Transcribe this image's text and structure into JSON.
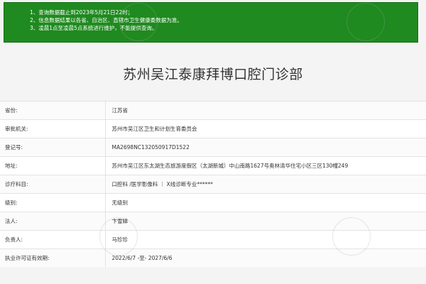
{
  "notice": {
    "lines": [
      "1、查询数据截止到2023年5月21日22时；",
      "2、信息数据结果以各省、自治区、直辖市卫生健康委数据为准。",
      "3、凌晨1点至凌晨5点系统进行维护，不能提供查询。"
    ]
  },
  "page_title": "苏州吴江泰康拜博口腔门诊部",
  "rows": [
    {
      "label": "省份:",
      "value": "江苏省"
    },
    {
      "label": "审批机关:",
      "value": "苏州市吴江区卫生和计划生育委员会"
    },
    {
      "label": "登记号:",
      "value": "MA2698NC132050917D1522"
    },
    {
      "label": "地址:",
      "value": "苏州市吴江区东太湖生态旅游度假区（太湖新城）中山南路1627号奥林清华住宅小区三区130幢249"
    },
    {
      "label": "诊疗科目:",
      "value": "口腔科 /医学影像科 ｜ X线诊断专业******"
    },
    {
      "label": "级别:",
      "value": "无级别"
    },
    {
      "label": "法人:",
      "value": "卞雪娣"
    },
    {
      "label": "负责人:",
      "value": "马珍珍"
    },
    {
      "label": "执业许可证有效期:",
      "value": "2022/6/7 -至- 2027/6/6"
    }
  ]
}
